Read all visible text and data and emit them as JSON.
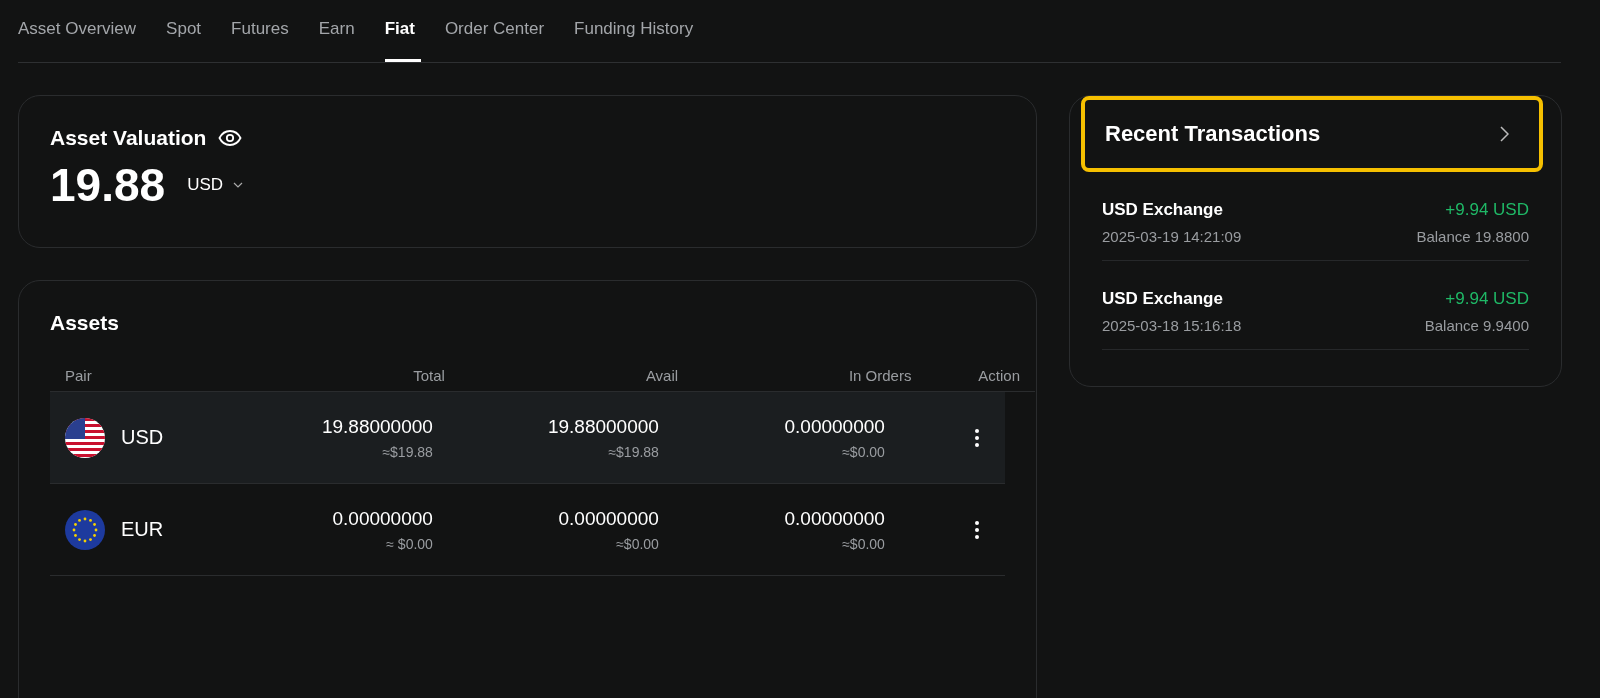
{
  "tabs": [
    {
      "label": "Asset Overview",
      "selected": false
    },
    {
      "label": "Spot",
      "selected": false
    },
    {
      "label": "Futures",
      "selected": false
    },
    {
      "label": "Earn",
      "selected": false
    },
    {
      "label": "Fiat",
      "selected": true
    },
    {
      "label": "Order Center",
      "selected": false
    },
    {
      "label": "Funding History",
      "selected": false
    }
  ],
  "valuation": {
    "title": "Asset Valuation",
    "amount": "19.88",
    "currency": "USD"
  },
  "assets": {
    "title": "Assets",
    "columns": [
      "Pair",
      "Total",
      "Avail",
      "In Orders",
      "Action"
    ],
    "rows": [
      {
        "kind": "usd",
        "pair": "USD",
        "total": "19.88000000",
        "total_approx": "≈$19.88",
        "avail": "19.88000000",
        "avail_approx": "≈$19.88",
        "in_orders": "0.00000000",
        "in_orders_approx": "≈$0.00",
        "selected": true
      },
      {
        "kind": "eur",
        "pair": "EUR",
        "total": "0.00000000",
        "total_approx": "≈ $0.00",
        "avail": "0.00000000",
        "avail_approx": "≈$0.00",
        "in_orders": "0.00000000",
        "in_orders_approx": "≈$0.00",
        "selected": false
      }
    ]
  },
  "recent_transactions": {
    "title": "Recent Transactions",
    "highlighted": true,
    "items": [
      {
        "title": "USD Exchange",
        "time": "2025-03-19 14:21:09",
        "amount": "+9.94 USD",
        "balance": "Balance 19.8800"
      },
      {
        "title": "USD Exchange",
        "time": "2025-03-18 15:16:18",
        "amount": "+9.94 USD",
        "balance": "Balance 9.9400"
      }
    ]
  }
}
